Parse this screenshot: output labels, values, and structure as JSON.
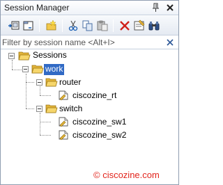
{
  "window": {
    "title": "Session Manager",
    "pin_icon": "pin-icon",
    "close_icon": "close-icon"
  },
  "toolbar": {
    "buttons": [
      {
        "name": "connect-button",
        "icon": "connect-icon"
      },
      {
        "name": "connect-tab-button",
        "icon": "connect-tab-icon"
      },
      {
        "name": "new-session-button",
        "icon": "new-session-icon"
      },
      {
        "name": "cut-button",
        "icon": "scissors-icon"
      },
      {
        "name": "copy-button",
        "icon": "copy-icon"
      },
      {
        "name": "paste-button",
        "icon": "paste-icon"
      },
      {
        "name": "delete-button",
        "icon": "delete-x-icon"
      },
      {
        "name": "properties-button",
        "icon": "properties-icon"
      },
      {
        "name": "find-button",
        "icon": "binoculars-icon"
      }
    ]
  },
  "filter": {
    "placeholder": "Filter by session name <Alt+I>",
    "value": ""
  },
  "tree": {
    "root": "Sessions",
    "folder_work": "work",
    "folder_router": "router",
    "session_rt": "ciscozine_rt",
    "folder_switch": "switch",
    "session_sw1": "ciscozine_sw1",
    "session_sw2": "ciscozine_sw2",
    "selected": "work"
  },
  "watermark": "© ciscozine.com",
  "colors": {
    "selection": "#316ac5",
    "watermark": "#e2241c",
    "folder": "#f2c94c"
  }
}
